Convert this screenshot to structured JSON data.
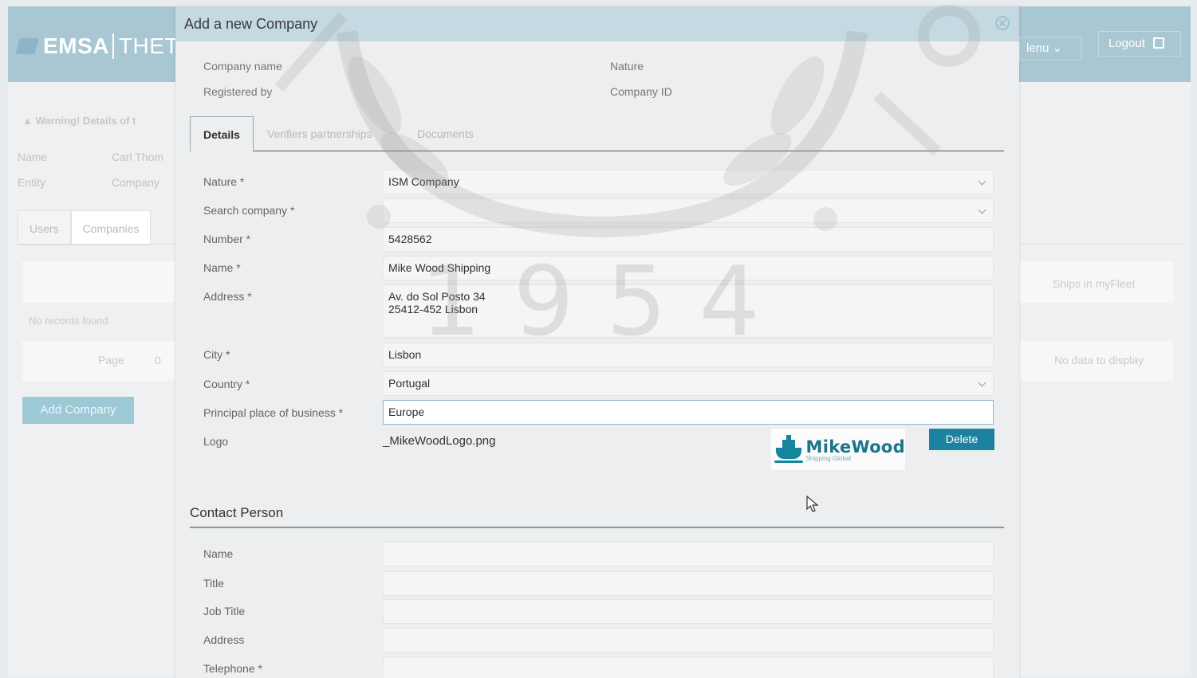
{
  "app": {
    "brand": "EMSA",
    "system": "THET",
    "menu_label": "lenu",
    "logout_label": "Logout",
    "warning_text": "Warning! Details of t",
    "home_label": "Name",
    "home_value": "Carl Thom",
    "entity_label": "Entity",
    "entity_value": "Company",
    "tabs": [
      "Users",
      "Companies"
    ],
    "no_records": "No records found",
    "page_label": "Page",
    "page_value": "0",
    "ships_label": "Ships in myFleet",
    "no_data": "No data to display",
    "add_company_label": "Add Company"
  },
  "modal": {
    "title": "Add a new Company",
    "summary": {
      "company_name_label": "Company name",
      "registered_by_label": "Registered by",
      "nature_label": "Nature",
      "company_id_label": "Company ID"
    },
    "tabs": [
      "Details",
      "Verifiers partnerships",
      "Documents"
    ],
    "form": {
      "nature": {
        "label": "Nature *",
        "value": "ISM Company"
      },
      "search_company": {
        "label": "Search company *",
        "value": ""
      },
      "number": {
        "label": "Number *",
        "value": "5428562"
      },
      "name": {
        "label": "Name *",
        "value": "Mike Wood Shipping"
      },
      "address": {
        "label": "Address *",
        "value": "Av. do Sol Posto 34\n25412-452 Lisbon"
      },
      "city": {
        "label": "City *",
        "value": "Lisbon"
      },
      "country": {
        "label": "Country *",
        "value": "Portugal"
      },
      "principal_place": {
        "label": "Principal place of business *",
        "value": "Europe"
      },
      "logo": {
        "label": "Logo",
        "file": "_MikeWoodLogo.png"
      }
    },
    "logo_image": {
      "main": "MikeWood",
      "sub": "Shipping Global"
    },
    "delete_label": "Delete",
    "contact": {
      "title": "Contact Person",
      "fields": [
        {
          "label": "Name",
          "value": ""
        },
        {
          "label": "Title",
          "value": ""
        },
        {
          "label": "Job Title",
          "value": ""
        },
        {
          "label": "Address",
          "value": ""
        },
        {
          "label": "Telephone *",
          "value": ""
        }
      ]
    }
  },
  "watermark": {
    "year": "1954"
  },
  "colors": {
    "header": "#a9c6d3",
    "modal_title_bar": "#c5d9e2",
    "accent": "#1b82a2",
    "add_button": "#9dc9d6"
  }
}
